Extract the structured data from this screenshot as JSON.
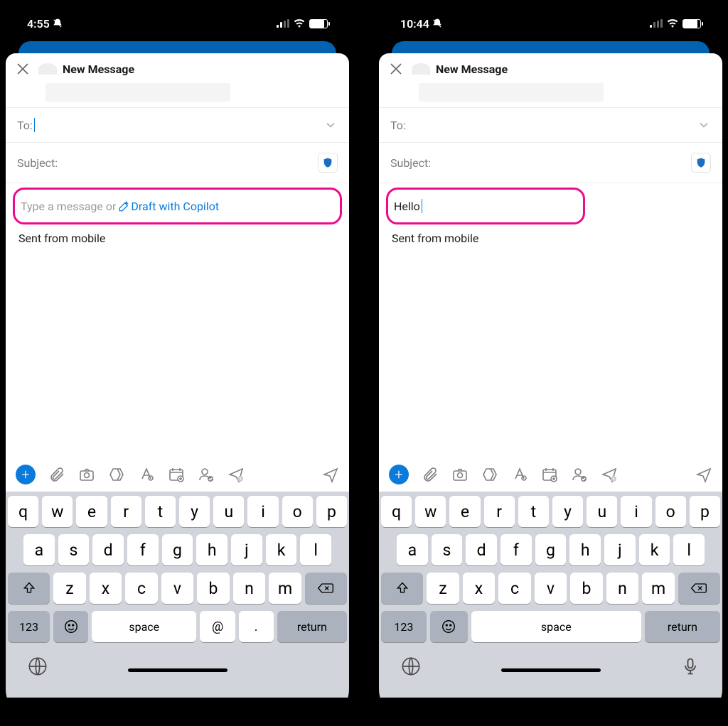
{
  "left": {
    "status_time": "4:55",
    "header_title": "New Message",
    "to_label": "To:",
    "subject_label": "Subject:",
    "body_placeholder": "Type a message or ",
    "copilot_text": "Draft with Copilot",
    "body_value": "",
    "signature": "Sent from mobile",
    "keyboard": {
      "row1": [
        "q",
        "w",
        "e",
        "r",
        "t",
        "y",
        "u",
        "i",
        "o",
        "p"
      ],
      "row2": [
        "a",
        "s",
        "d",
        "f",
        "g",
        "h",
        "j",
        "k",
        "l"
      ],
      "row3": [
        "z",
        "x",
        "c",
        "v",
        "b",
        "n",
        "m"
      ],
      "num_key": "123",
      "space": "space",
      "at": "@",
      "dot": ".",
      "return": "return"
    }
  },
  "right": {
    "status_time": "10:44",
    "header_title": "New Message",
    "to_label": "To:",
    "subject_label": "Subject:",
    "body_value": "Hello",
    "signature": "Sent from mobile",
    "keyboard": {
      "row1": [
        "q",
        "w",
        "e",
        "r",
        "t",
        "y",
        "u",
        "i",
        "o",
        "p"
      ],
      "row2": [
        "a",
        "s",
        "d",
        "f",
        "g",
        "h",
        "j",
        "k",
        "l"
      ],
      "row3": [
        "z",
        "x",
        "c",
        "v",
        "b",
        "n",
        "m"
      ],
      "num_key": "123",
      "space": "space",
      "return": "return"
    }
  }
}
